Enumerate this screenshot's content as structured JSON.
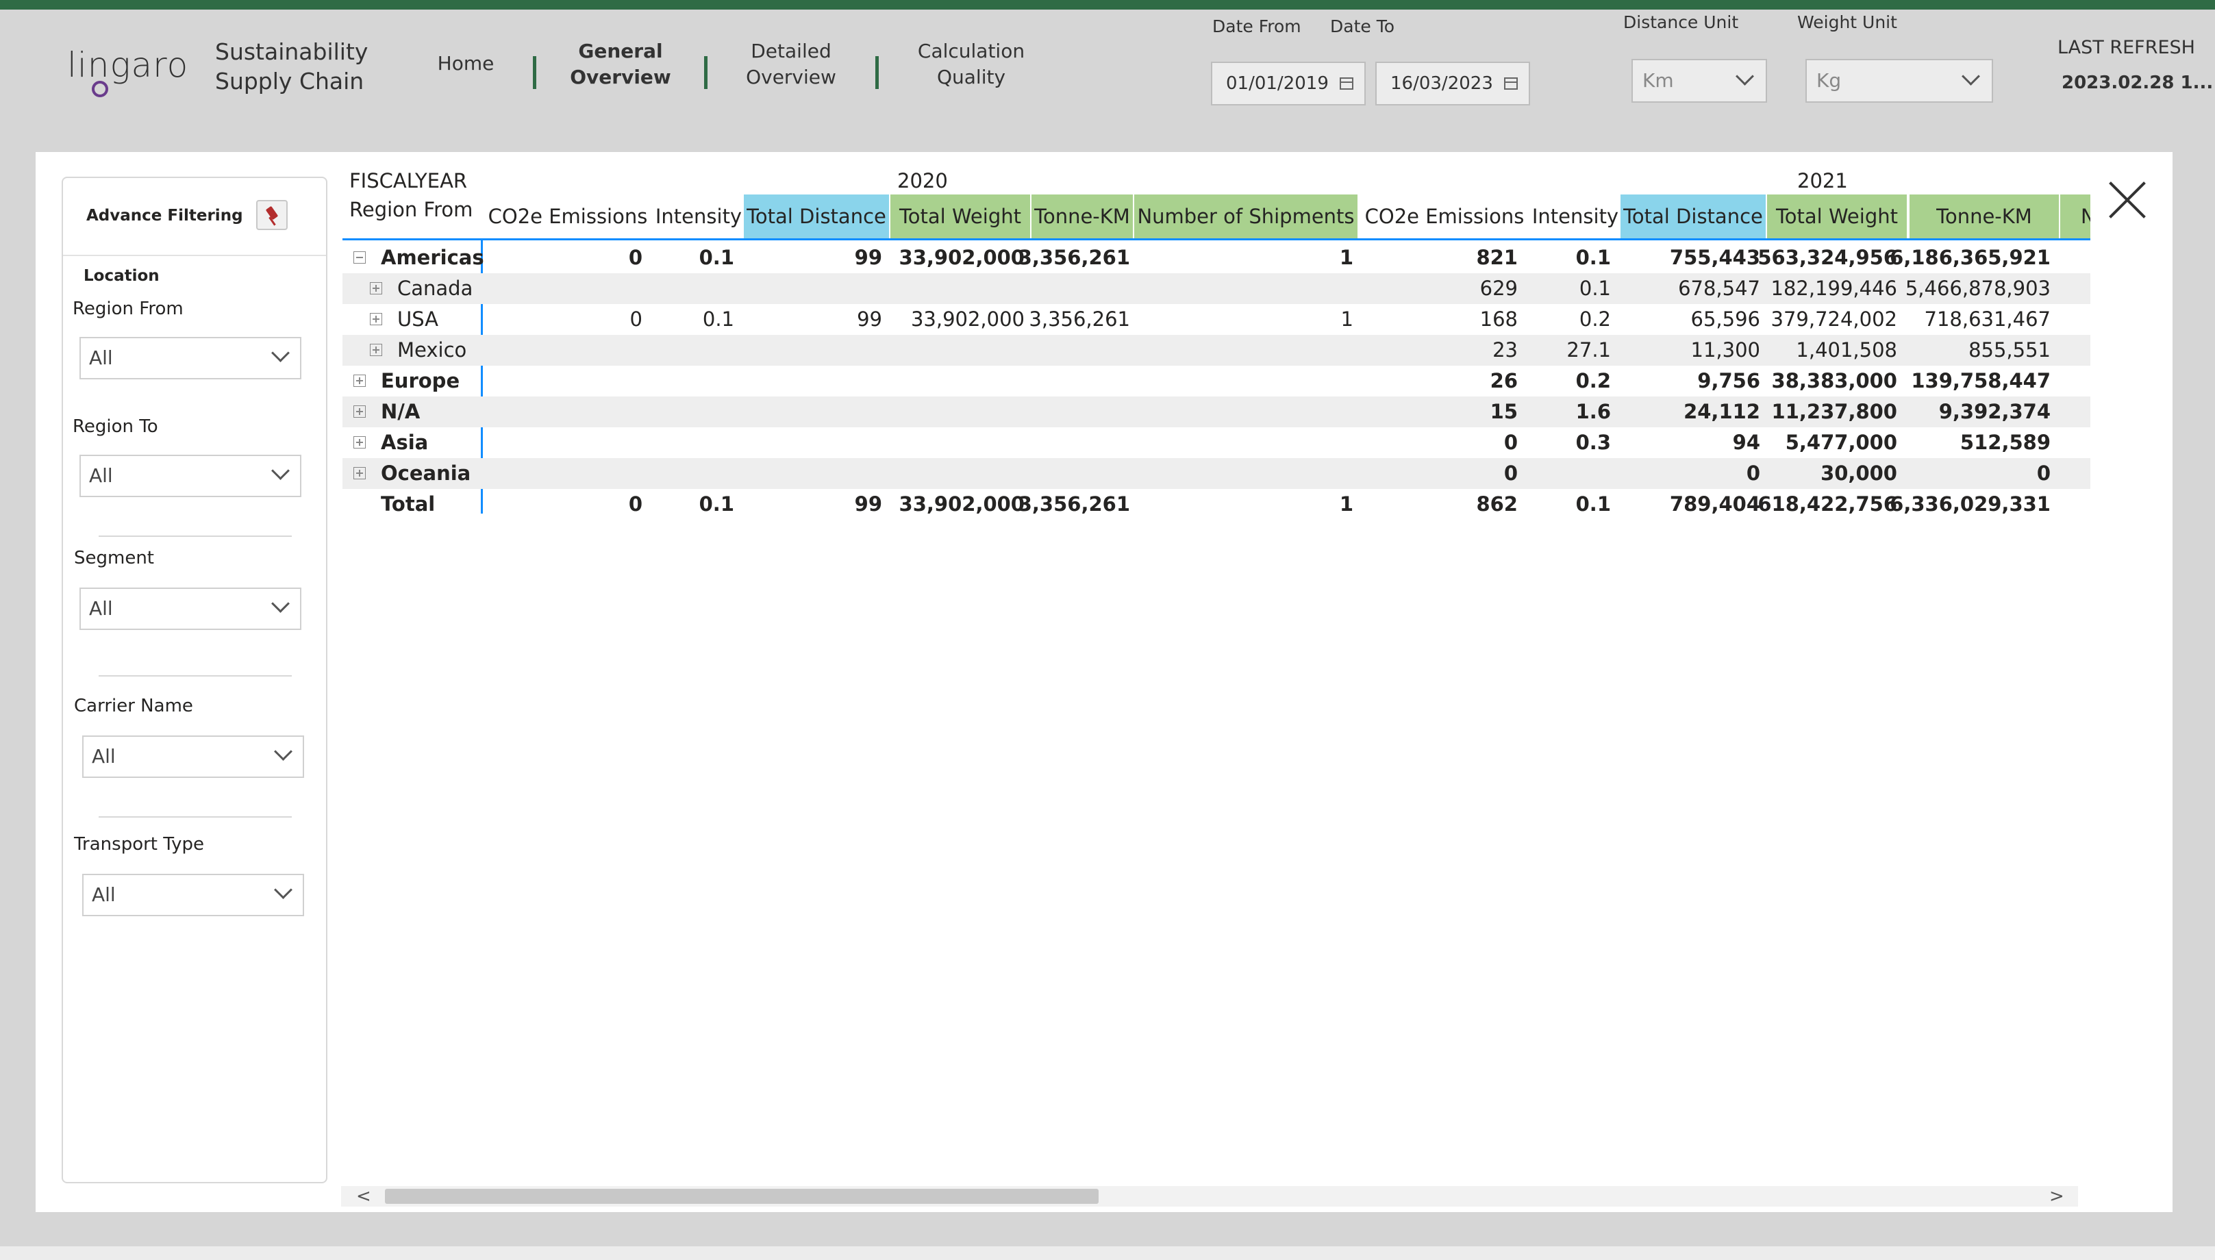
{
  "header": {
    "logo_text": "lingaro",
    "app_title_line1": "Sustainability",
    "app_title_line2": "Supply Chain",
    "nav": [
      {
        "line1": "Home",
        "line2": ""
      },
      {
        "line1": "General",
        "line2": "Overview"
      },
      {
        "line1": "Detailed",
        "line2": "Overview"
      },
      {
        "line1": "Calculation",
        "line2": "Quality"
      }
    ],
    "active_nav": "General Overview",
    "date_from_label": "Date From",
    "date_to_label": "Date To",
    "date_from": "01/01/2019",
    "date_to": "16/03/2023",
    "distance_unit_label": "Distance Unit",
    "distance_unit": "Km",
    "weight_unit_label": "Weight Unit",
    "weight_unit": "Kg",
    "last_refresh_label": "LAST REFRESH",
    "last_refresh_value": "2023.02.28 1..."
  },
  "filters": {
    "title": "Advance Filtering",
    "location_section": "Location",
    "region_from_label": "Region From",
    "region_from_value": "All",
    "region_to_label": "Region To",
    "region_to_value": "All",
    "segment_label": "Segment",
    "segment_value": "All",
    "carrier_label": "Carrier Name",
    "carrier_value": "All",
    "transport_label": "Transport Type",
    "transport_value": "All"
  },
  "matrix": {
    "fiscal_label": "FISCALYEAR",
    "row_header": "Region From",
    "years": [
      "2020",
      "2021"
    ],
    "columns_2020": [
      "CO2e Emissions",
      "Intensity",
      "Total Distance",
      "Total Weight",
      "Tonne-KM",
      "Number of Shipments"
    ],
    "columns_2021": [
      "CO2e Emissions",
      "Intensity",
      "Total Distance",
      "Total Weight",
      "Tonne-KM",
      "Nu"
    ],
    "header_colors": {
      "distance": "#8ad4eb",
      "weight_group": "#a9d18e"
    },
    "rows": [
      {
        "label": "Americas",
        "level": 0,
        "bold": true,
        "expanded": true,
        "y2020": [
          "0",
          "0.1",
          "99",
          "33,902,000",
          "3,356,261",
          "1"
        ],
        "y2021": [
          "821",
          "0.1",
          "755,443",
          "563,324,956",
          "6,186,365,921"
        ]
      },
      {
        "label": "Canada",
        "level": 1,
        "bold": false,
        "expanded": false,
        "y2020": [
          "",
          "",
          "",
          "",
          "",
          ""
        ],
        "y2021": [
          "629",
          "0.1",
          "678,547",
          "182,199,446",
          "5,466,878,903"
        ]
      },
      {
        "label": "USA",
        "level": 1,
        "bold": false,
        "expanded": false,
        "y2020": [
          "0",
          "0.1",
          "99",
          "33,902,000",
          "3,356,261",
          "1"
        ],
        "y2021": [
          "168",
          "0.2",
          "65,596",
          "379,724,002",
          "718,631,467"
        ]
      },
      {
        "label": "Mexico",
        "level": 1,
        "bold": false,
        "expanded": false,
        "y2020": [
          "",
          "",
          "",
          "",
          "",
          ""
        ],
        "y2021": [
          "23",
          "27.1",
          "11,300",
          "1,401,508",
          "855,551"
        ]
      },
      {
        "label": "Europe",
        "level": 0,
        "bold": true,
        "expanded": false,
        "y2020": [
          "",
          "",
          "",
          "",
          "",
          ""
        ],
        "y2021": [
          "26",
          "0.2",
          "9,756",
          "38,383,000",
          "139,758,447"
        ]
      },
      {
        "label": "N/A",
        "level": 0,
        "bold": true,
        "expanded": false,
        "y2020": [
          "",
          "",
          "",
          "",
          "",
          ""
        ],
        "y2021": [
          "15",
          "1.6",
          "24,112",
          "11,237,800",
          "9,392,374"
        ]
      },
      {
        "label": "Asia",
        "level": 0,
        "bold": true,
        "expanded": false,
        "y2020": [
          "",
          "",
          "",
          "",
          "",
          ""
        ],
        "y2021": [
          "0",
          "0.3",
          "94",
          "5,477,000",
          "512,589"
        ]
      },
      {
        "label": "Oceania",
        "level": 0,
        "bold": true,
        "expanded": false,
        "y2020": [
          "",
          "",
          "",
          "",
          "",
          ""
        ],
        "y2021": [
          "0",
          "",
          "0",
          "30,000",
          "0"
        ]
      }
    ],
    "total": {
      "label": "Total",
      "y2020": [
        "0",
        "0.1",
        "99",
        "33,902,000",
        "3,356,261",
        "1"
      ],
      "y2021": [
        "862",
        "0.1",
        "789,404",
        "618,422,756",
        "6,336,029,331"
      ]
    }
  },
  "scrollbar": {
    "left_arrow": "<",
    "right_arrow": ">"
  }
}
